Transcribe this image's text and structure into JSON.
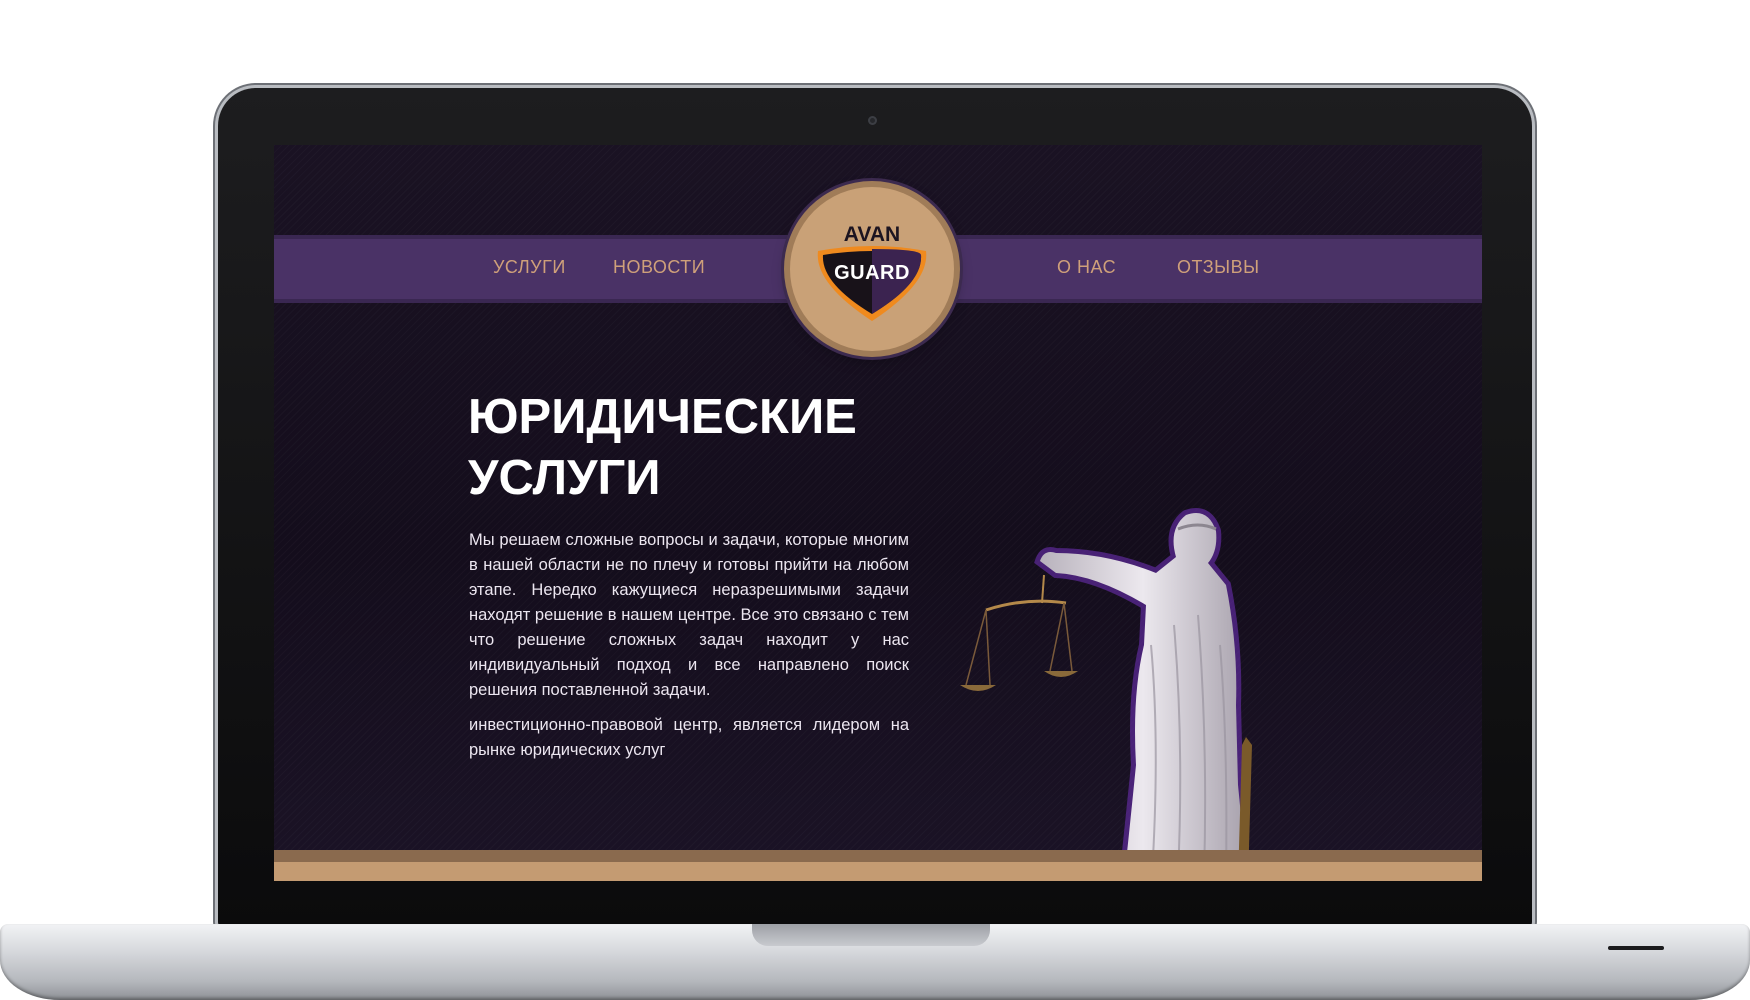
{
  "nav": {
    "items": [
      {
        "label": "УСЛУГИ"
      },
      {
        "label": "НОВОСТИ"
      },
      {
        "label": "О НАС"
      },
      {
        "label": "ОТЗЫВЫ"
      }
    ]
  },
  "logo": {
    "top": "AVAN",
    "bottom": "GUARD"
  },
  "hero": {
    "title_line1": "ЮРИДИЧЕСКИЕ",
    "title_line2": "УСЛУГИ",
    "paragraph1": "Мы решаем сложные вопросы и задачи, которые многим в нашей области не по плечу и готовы прийти на любом этапе. Нередко кажущиеся неразрешимыми задачи находят решение в нашем центре. Все это связано с тем что решение сложных задач находит у нас индивидуальный подход и все направлено поиск решения поставленной задачи.",
    "paragraph2": "инвестиционно-правовой центр, является лидером на рынке юридических услуг"
  },
  "colors": {
    "nav_band": "#4a3266",
    "nav_text": "#cfa07a",
    "background": "#140d1c",
    "accent_gold": "#c49b72"
  },
  "icons": {
    "statue": "lady-justice-statue-icon",
    "shield": "shield-icon"
  }
}
